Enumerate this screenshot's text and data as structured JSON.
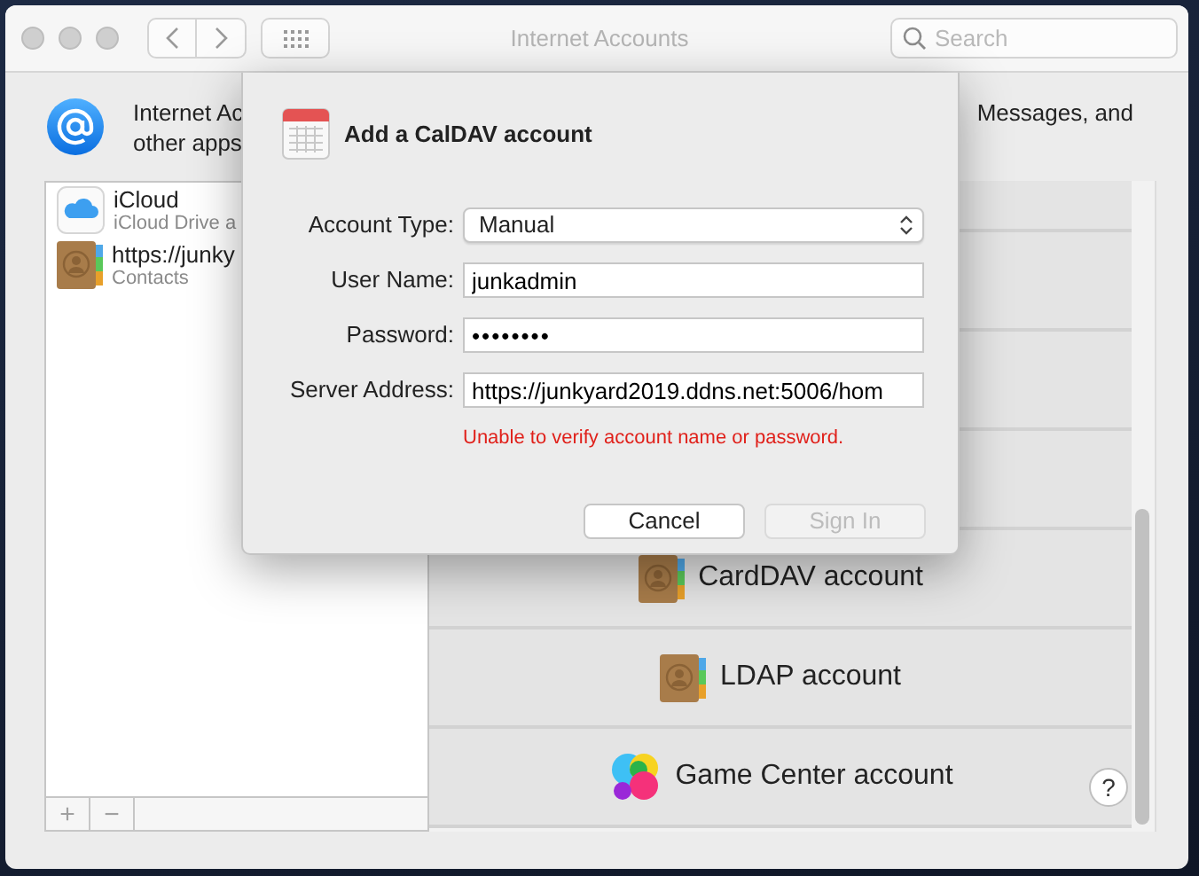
{
  "window": {
    "title": "Internet Accounts",
    "search": {
      "placeholder": "Search"
    }
  },
  "header": {
    "text_left": [
      "Internet Ac",
      "other apps"
    ],
    "text_right": "Messages, and"
  },
  "accounts": [
    {
      "name": "iCloud",
      "detail": "iCloud Drive a",
      "kind": "icloud"
    },
    {
      "name": "https://junky",
      "detail": "Contacts",
      "kind": "contacts"
    }
  ],
  "list_buttons": [
    "+",
    "−"
  ],
  "account_types": [
    {
      "label": "CardDAV account",
      "kind": "contacts"
    },
    {
      "label": "LDAP account",
      "kind": "contacts"
    },
    {
      "label": "Game Center account",
      "kind": "gamecenter"
    }
  ],
  "help": "?",
  "dialog": {
    "title": "Add a CalDAV account",
    "fields": [
      {
        "label": "Account Type:",
        "kind": "popup",
        "value": "Manual"
      },
      {
        "label": "User Name:",
        "kind": "text",
        "value": "junkadmin"
      },
      {
        "label": "Password:",
        "kind": "password",
        "value": "••••••••"
      },
      {
        "label": "Server Address:",
        "kind": "text",
        "value": "https://junkyard2019.ddns.net:5006/hom"
      }
    ],
    "error": "Unable to verify account name or password.",
    "buttons": [
      {
        "label": "Cancel",
        "disabled": false
      },
      {
        "label": "Sign In",
        "disabled": true
      }
    ]
  }
}
